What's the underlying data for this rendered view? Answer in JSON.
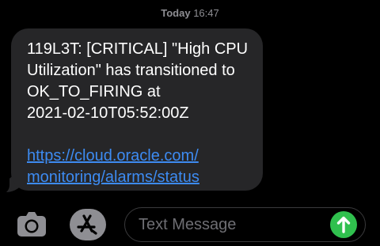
{
  "header": {
    "day": "Today",
    "time": "16:47"
  },
  "message": {
    "text": "119L3T: [CRITICAL] \"High CPU\nUtilization\" has transitioned to\nOK_TO_FIRING at\n2021-02-10T05:52:00Z",
    "link": "https://cloud.oracle.com/\nmonitoring/alarms/status"
  },
  "composer": {
    "placeholder": "Text Message"
  },
  "icons": {
    "camera": "camera-icon",
    "appstore": "app-store-icon",
    "send": "send-arrow-up-icon"
  },
  "colors": {
    "bubble": "#262628",
    "link": "#3d8bf2",
    "send": "#30c04e",
    "timestamp": "#8e8e93"
  }
}
